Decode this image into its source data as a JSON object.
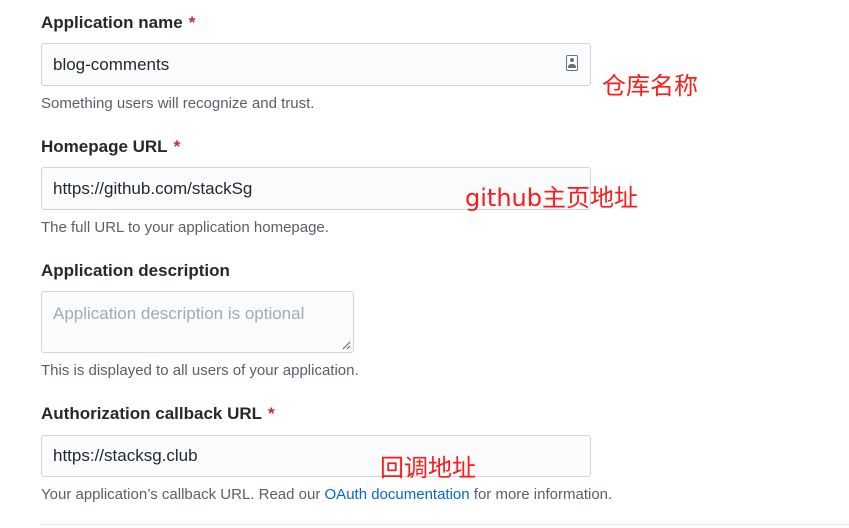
{
  "form": {
    "app_name": {
      "label": "Application name",
      "required_mark": "*",
      "value": "blog-comments",
      "note": "Something users will recognize and trust.",
      "field_icon": "contact-card-icon"
    },
    "homepage": {
      "label": "Homepage URL",
      "required_mark": "*",
      "value": "https://github.com/stackSg",
      "note": "The full URL to your application homepage."
    },
    "description": {
      "label": "Application description",
      "placeholder": "Application description is optional",
      "note": "This is displayed to all users of your application."
    },
    "callback": {
      "label": "Authorization callback URL",
      "required_mark": "*",
      "value": "https://stacksg.club",
      "note_before": "Your application’s callback URL. Read our",
      "note_link": "OAuth documentation",
      "note_after": "for more information."
    }
  },
  "annotations": {
    "app_name": "仓库名称",
    "homepage": "github主页地址",
    "callback": "回调地址"
  },
  "colors": {
    "required": "#cb2431",
    "link": "#0366d6",
    "annotation": "#ff1a1a",
    "input_bg": "#fafbfc",
    "input_border": "#d1d5da",
    "note_text": "#586069"
  }
}
